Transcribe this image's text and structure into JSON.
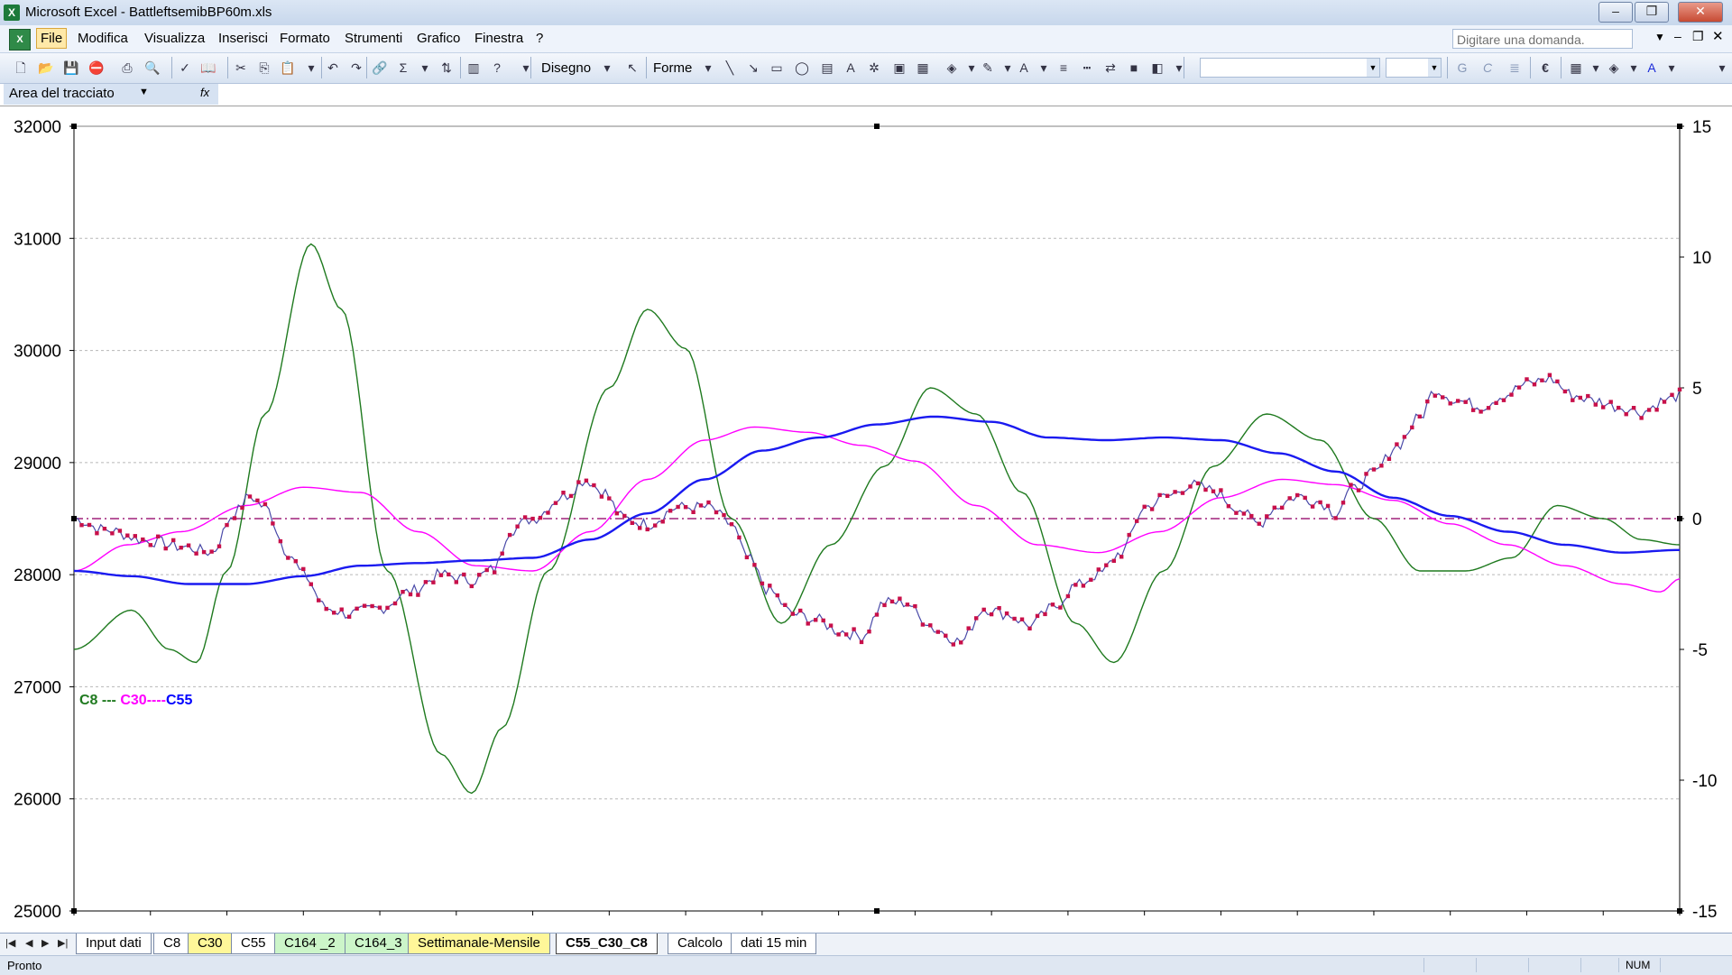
{
  "window": {
    "title": "Microsoft Excel - BattleftsemibBP60m.xls",
    "app_icon": "excel-icon",
    "buttons": {
      "minimize": "–",
      "restore": "❐",
      "close": "✕"
    }
  },
  "menu": {
    "items": [
      "File",
      "Modifica",
      "Visualizza",
      "Inserisci",
      "Formato",
      "Strumenti",
      "Grafico",
      "Finestra",
      "?"
    ],
    "ask_placeholder": "Digitare una domanda."
  },
  "toolbar": {
    "drawing_label": "Disegno",
    "shapes_label": "Forme",
    "bold_label": "G",
    "italic_label": "C",
    "euro_label": "€"
  },
  "chart_object": {
    "name": "Area del tracciato"
  },
  "chart_data": {
    "type": "line",
    "legend": [
      {
        "text": "C8 ---",
        "color": "#1f7a1f"
      },
      {
        "text": " C30----",
        "color": "#ff00ff"
      },
      {
        "text": "C55",
        "color": "#0000ff"
      }
    ],
    "primary_axis": {
      "ylim": [
        25000,
        32000
      ],
      "ticks": [
        "25000",
        "26000",
        "27000",
        "28000",
        "29000",
        "30000",
        "31000",
        "32000"
      ],
      "side": "left"
    },
    "secondary_axis": {
      "ylim": [
        -15,
        15
      ],
      "ticks": [
        "-15",
        "-10",
        "-5",
        "0",
        "5",
        "10",
        "15"
      ],
      "side": "right"
    },
    "gridlines": "dashed horizontal",
    "x_count": 420,
    "reference_line": {
      "axis": "secondary",
      "value": 0,
      "color": "#a0207a",
      "style": "dash-dot"
    },
    "series": [
      {
        "axis": "primary",
        "color_line": "#4a4aa8",
        "color_marker": "#c8104a",
        "anchors": [
          [
            0,
            28500
          ],
          [
            8,
            28400
          ],
          [
            20,
            28300
          ],
          [
            28,
            28250
          ],
          [
            36,
            28200
          ],
          [
            42,
            28550
          ],
          [
            46,
            28700
          ],
          [
            50,
            28600
          ],
          [
            56,
            28200
          ],
          [
            60,
            28000
          ],
          [
            66,
            27700
          ],
          [
            72,
            27650
          ],
          [
            80,
            27700
          ],
          [
            88,
            27850
          ],
          [
            96,
            28000
          ],
          [
            104,
            27950
          ],
          [
            110,
            28050
          ],
          [
            114,
            28400
          ],
          [
            120,
            28500
          ],
          [
            128,
            28700
          ],
          [
            134,
            28850
          ],
          [
            138,
            28750
          ],
          [
            144,
            28500
          ],
          [
            150,
            28450
          ],
          [
            158,
            28600
          ],
          [
            166,
            28600
          ],
          [
            172,
            28450
          ],
          [
            176,
            28150
          ],
          [
            182,
            27850
          ],
          [
            188,
            27650
          ],
          [
            194,
            27600
          ],
          [
            200,
            27500
          ],
          [
            206,
            27450
          ],
          [
            212,
            27750
          ],
          [
            218,
            27750
          ],
          [
            222,
            27600
          ],
          [
            226,
            27500
          ],
          [
            232,
            27400
          ],
          [
            238,
            27700
          ],
          [
            244,
            27650
          ],
          [
            250,
            27550
          ],
          [
            256,
            27700
          ],
          [
            262,
            27900
          ],
          [
            268,
            28000
          ],
          [
            274,
            28200
          ],
          [
            280,
            28600
          ],
          [
            286,
            28700
          ],
          [
            292,
            28800
          ],
          [
            298,
            28750
          ],
          [
            304,
            28600
          ],
          [
            310,
            28450
          ],
          [
            314,
            28600
          ],
          [
            320,
            28700
          ],
          [
            326,
            28650
          ],
          [
            330,
            28550
          ],
          [
            334,
            28750
          ],
          [
            340,
            28900
          ],
          [
            346,
            29150
          ],
          [
            352,
            29400
          ],
          [
            356,
            29650
          ],
          [
            362,
            29550
          ],
          [
            368,
            29500
          ],
          [
            374,
            29600
          ],
          [
            380,
            29700
          ],
          [
            386,
            29750
          ],
          [
            392,
            29600
          ],
          [
            398,
            29550
          ],
          [
            404,
            29500
          ],
          [
            410,
            29450
          ],
          [
            416,
            29550
          ],
          [
            420,
            29600
          ]
        ]
      },
      {
        "axis": "secondary",
        "color": "#1f7a1f",
        "anchors": [
          [
            0,
            -5
          ],
          [
            15,
            -3.5
          ],
          [
            25,
            -5
          ],
          [
            32,
            -5.5
          ],
          [
            40,
            -2
          ],
          [
            50,
            4
          ],
          [
            62,
            10.5
          ],
          [
            70,
            8
          ],
          [
            82,
            -2
          ],
          [
            96,
            -9
          ],
          [
            104,
            -10.5
          ],
          [
            112,
            -8
          ],
          [
            124,
            -2
          ],
          [
            140,
            5
          ],
          [
            150,
            8
          ],
          [
            160,
            6.5
          ],
          [
            172,
            0
          ],
          [
            185,
            -4
          ],
          [
            198,
            -1
          ],
          [
            212,
            2
          ],
          [
            224,
            5
          ],
          [
            236,
            4
          ],
          [
            248,
            1
          ],
          [
            262,
            -4
          ],
          [
            272,
            -5.5
          ],
          [
            285,
            -2
          ],
          [
            298,
            2
          ],
          [
            312,
            4
          ],
          [
            326,
            3
          ],
          [
            340,
            0
          ],
          [
            352,
            -2
          ],
          [
            364,
            -2
          ],
          [
            376,
            -1.5
          ],
          [
            388,
            0.5
          ],
          [
            400,
            0
          ],
          [
            410,
            -0.8
          ],
          [
            420,
            -1
          ]
        ]
      },
      {
        "axis": "secondary",
        "color": "#ff00ff",
        "anchors": [
          [
            0,
            -2
          ],
          [
            14,
            -1
          ],
          [
            28,
            -0.5
          ],
          [
            45,
            0.5
          ],
          [
            60,
            1.2
          ],
          [
            75,
            1
          ],
          [
            90,
            -0.5
          ],
          [
            105,
            -1.8
          ],
          [
            120,
            -2
          ],
          [
            135,
            -0.5
          ],
          [
            150,
            1.5
          ],
          [
            165,
            3
          ],
          [
            178,
            3.5
          ],
          [
            192,
            3.3
          ],
          [
            206,
            2.8
          ],
          [
            220,
            2.2
          ],
          [
            236,
            0.5
          ],
          [
            252,
            -1
          ],
          [
            268,
            -1.3
          ],
          [
            284,
            -0.5
          ],
          [
            300,
            0.8
          ],
          [
            316,
            1.5
          ],
          [
            330,
            1.3
          ],
          [
            345,
            0.7
          ],
          [
            360,
            -0.2
          ],
          [
            375,
            -1
          ],
          [
            390,
            -1.8
          ],
          [
            405,
            -2.5
          ],
          [
            415,
            -2.8
          ],
          [
            420,
            -2.3
          ]
        ]
      },
      {
        "axis": "secondary",
        "color": "#1a1af0",
        "anchors": [
          [
            0,
            -2
          ],
          [
            15,
            -2.2
          ],
          [
            30,
            -2.5
          ],
          [
            45,
            -2.5
          ],
          [
            60,
            -2.2
          ],
          [
            75,
            -1.8
          ],
          [
            90,
            -1.7
          ],
          [
            105,
            -1.6
          ],
          [
            120,
            -1.5
          ],
          [
            135,
            -0.8
          ],
          [
            150,
            0.2
          ],
          [
            165,
            1.5
          ],
          [
            180,
            2.6
          ],
          [
            195,
            3.1
          ],
          [
            210,
            3.6
          ],
          [
            225,
            3.9
          ],
          [
            240,
            3.7
          ],
          [
            255,
            3.1
          ],
          [
            270,
            3.0
          ],
          [
            285,
            3.1
          ],
          [
            300,
            3.0
          ],
          [
            315,
            2.5
          ],
          [
            330,
            1.8
          ],
          [
            345,
            0.8
          ],
          [
            360,
            0.1
          ],
          [
            375,
            -0.5
          ],
          [
            390,
            -1.0
          ],
          [
            405,
            -1.3
          ],
          [
            420,
            -1.2
          ]
        ]
      }
    ]
  },
  "sheet_tabs": [
    {
      "label": "Input dati",
      "color": "plain"
    },
    {
      "label": "C8",
      "color": "plain"
    },
    {
      "label": "C30",
      "color": "yellow"
    },
    {
      "label": "C55",
      "color": "plain"
    },
    {
      "label": "C164 _2",
      "color": "green"
    },
    {
      "label": "C164_3",
      "color": "green"
    },
    {
      "label": "Settimanale-Mensile",
      "color": "yellow"
    },
    {
      "label": "C55_C30_C8",
      "color": "active"
    },
    {
      "label": "Calcolo",
      "color": "plain"
    },
    {
      "label": "dati 15 min",
      "color": "plain"
    }
  ],
  "status": {
    "text": "Pronto",
    "num": "NUM"
  }
}
